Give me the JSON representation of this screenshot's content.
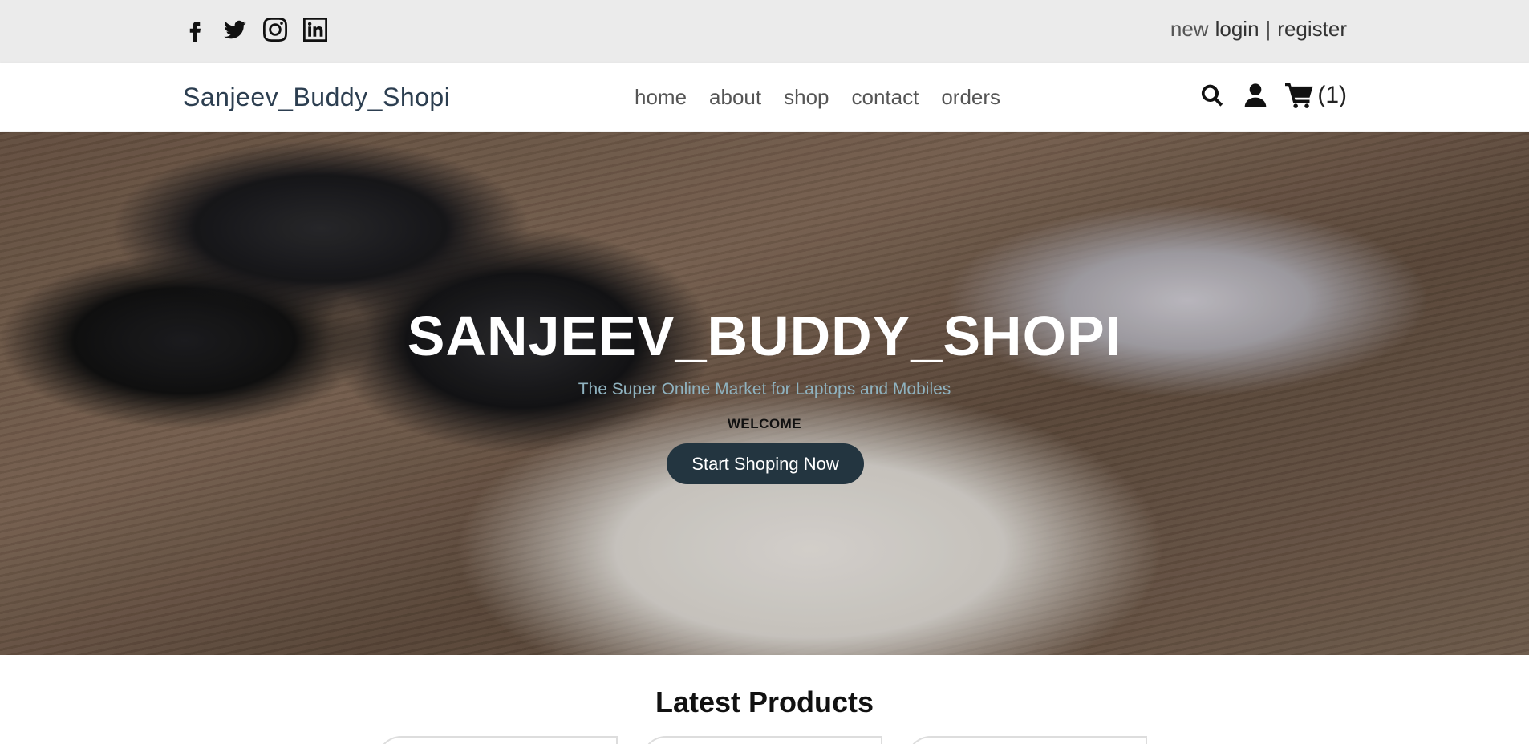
{
  "topbar": {
    "socials": [
      {
        "icon": "facebook-icon"
      },
      {
        "icon": "twitter-icon"
      },
      {
        "icon": "instagram-icon"
      },
      {
        "icon": "linkedin-icon"
      }
    ],
    "auth_prefix": "new",
    "login_label": "login",
    "separator": "|",
    "register_label": "register"
  },
  "header": {
    "logo": "Sanjeev_Buddy_Shopi",
    "nav": [
      "home",
      "about",
      "shop",
      "contact",
      "orders"
    ],
    "cart_count": "(1)"
  },
  "hero": {
    "title": "SANJEEV_BUDDY_SHOPI",
    "subtitle": "The Super Online Market for Laptops and Mobiles",
    "welcome": "WELCOME",
    "button": "Start Shoping Now"
  },
  "latest": {
    "heading": "Latest Products"
  },
  "colors": {
    "button_bg": "#233540",
    "subtitle": "#8fb2bf",
    "topbar_bg": "#ebebeb"
  }
}
